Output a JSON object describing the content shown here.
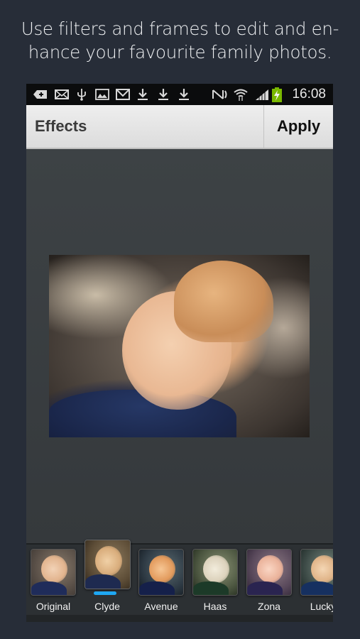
{
  "promo": {
    "line1": "Use filters and frames to edit and en-",
    "line2": "hance your favourite family photos."
  },
  "statusbar": {
    "left_icons": [
      "add-notification-icon",
      "mail-icon",
      "usb-icon",
      "gallery-icon",
      "gmail-icon",
      "download-icon",
      "download-icon",
      "download-icon"
    ],
    "right_icons": [
      "nfc-icon",
      "wifi-icon",
      "signal-icon",
      "battery-charging-icon"
    ],
    "time": "16:08"
  },
  "actionbar": {
    "title": "Effects",
    "apply_label": "Apply"
  },
  "colors": {
    "accent": "#1ea7f2",
    "background": "#272d38",
    "canvas": "#3b4043",
    "filterbar": "#2c3033",
    "battery": "#7ab800"
  },
  "filters": {
    "selected": "Clyde",
    "items": [
      {
        "label": "Original"
      },
      {
        "label": "Clyde"
      },
      {
        "label": "Avenue"
      },
      {
        "label": "Haas"
      },
      {
        "label": "Zona"
      },
      {
        "label": "Lucky"
      }
    ]
  }
}
